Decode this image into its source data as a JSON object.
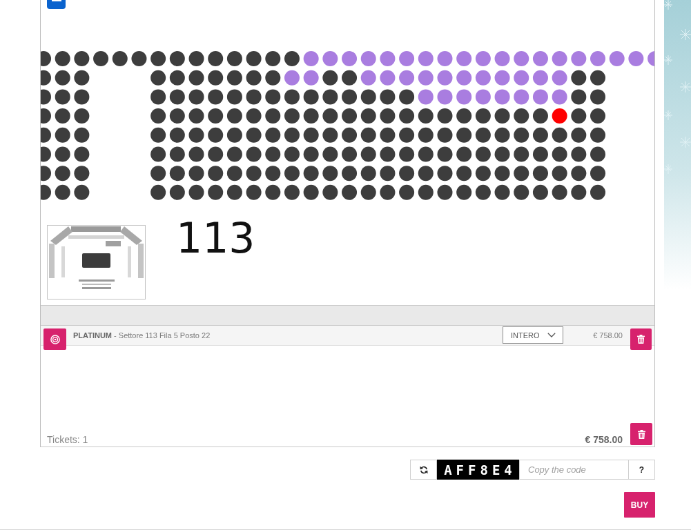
{
  "seat_map": {
    "rows": [
      {
        "blocks": [
          {
            "seats": [
              {
                "kind": "sold",
                "selected": false
              },
              {
                "kind": "sold",
                "selected": false
              },
              {
                "kind": "sold",
                "selected": false
              },
              {
                "kind": "sold",
                "selected": false
              },
              {
                "kind": "sold",
                "selected": false
              },
              {
                "kind": "sold",
                "selected": false
              },
              {
                "kind": "sold",
                "selected": false
              },
              {
                "kind": "sold",
                "selected": false
              },
              {
                "kind": "sold",
                "selected": false
              },
              {
                "kind": "sold",
                "selected": false
              },
              {
                "kind": "sold",
                "selected": false
              },
              {
                "kind": "sold",
                "selected": false
              },
              {
                "kind": "sold",
                "selected": false
              },
              {
                "kind": "sold",
                "selected": false
              },
              {
                "kind": "free",
                "selected": false
              },
              {
                "kind": "free",
                "selected": false
              },
              {
                "kind": "free",
                "selected": false
              },
              {
                "kind": "free",
                "selected": false
              },
              {
                "kind": "free",
                "selected": false
              },
              {
                "kind": "free",
                "selected": false
              },
              {
                "kind": "free",
                "selected": false
              },
              {
                "kind": "free",
                "selected": false
              },
              {
                "kind": "free",
                "selected": false
              },
              {
                "kind": "free",
                "selected": false
              },
              {
                "kind": "free",
                "selected": false
              },
              {
                "kind": "free",
                "selected": false
              },
              {
                "kind": "free",
                "selected": false
              },
              {
                "kind": "free",
                "selected": false
              },
              {
                "kind": "free",
                "selected": false
              },
              {
                "kind": "free",
                "selected": false
              },
              {
                "kind": "free",
                "selected": false
              },
              {
                "kind": "free",
                "selected": false
              },
              {
                "kind": "free",
                "selected": false
              }
            ]
          }
        ]
      },
      {
        "blocks": [
          {
            "seats": [
              {
                "kind": "sold",
                "selected": false
              },
              {
                "kind": "sold",
                "selected": false
              },
              {
                "kind": "sold",
                "selected": false
              }
            ]
          },
          {
            "seats": [
              {
                "kind": "sold",
                "selected": false
              },
              {
                "kind": "sold",
                "selected": false
              },
              {
                "kind": "sold",
                "selected": false
              },
              {
                "kind": "sold",
                "selected": false
              },
              {
                "kind": "sold",
                "selected": false
              },
              {
                "kind": "sold",
                "selected": false
              },
              {
                "kind": "sold",
                "selected": false
              },
              {
                "kind": "free",
                "selected": false
              },
              {
                "kind": "free",
                "selected": false
              },
              {
                "kind": "sold",
                "selected": false
              },
              {
                "kind": "sold",
                "selected": false
              },
              {
                "kind": "free",
                "selected": false
              },
              {
                "kind": "free",
                "selected": false
              },
              {
                "kind": "free",
                "selected": false
              },
              {
                "kind": "free",
                "selected": false
              },
              {
                "kind": "free",
                "selected": false
              },
              {
                "kind": "free",
                "selected": false
              },
              {
                "kind": "free",
                "selected": false
              },
              {
                "kind": "free",
                "selected": false
              },
              {
                "kind": "free",
                "selected": false
              },
              {
                "kind": "free",
                "selected": false
              },
              {
                "kind": "free",
                "selected": false
              },
              {
                "kind": "sold",
                "selected": false
              },
              {
                "kind": "sold",
                "selected": false
              }
            ]
          }
        ]
      },
      {
        "blocks": [
          {
            "seats": [
              {
                "kind": "sold",
                "selected": false
              },
              {
                "kind": "sold",
                "selected": false
              },
              {
                "kind": "sold",
                "selected": false
              }
            ]
          },
          {
            "seats": [
              {
                "kind": "sold",
                "selected": false
              },
              {
                "kind": "sold",
                "selected": false
              },
              {
                "kind": "sold",
                "selected": false
              },
              {
                "kind": "sold",
                "selected": false
              },
              {
                "kind": "sold",
                "selected": false
              },
              {
                "kind": "sold",
                "selected": false
              },
              {
                "kind": "sold",
                "selected": false
              },
              {
                "kind": "sold",
                "selected": false
              },
              {
                "kind": "sold",
                "selected": false
              },
              {
                "kind": "sold",
                "selected": false
              },
              {
                "kind": "sold",
                "selected": false
              },
              {
                "kind": "sold",
                "selected": false
              },
              {
                "kind": "sold",
                "selected": false
              },
              {
                "kind": "sold",
                "selected": false
              },
              {
                "kind": "free",
                "selected": false
              },
              {
                "kind": "free",
                "selected": false
              },
              {
                "kind": "free",
                "selected": false
              },
              {
                "kind": "free",
                "selected": false
              },
              {
                "kind": "free",
                "selected": false
              },
              {
                "kind": "free",
                "selected": false
              },
              {
                "kind": "free",
                "selected": false
              },
              {
                "kind": "free",
                "selected": false
              },
              {
                "kind": "sold",
                "selected": false
              },
              {
                "kind": "sold",
                "selected": false
              }
            ]
          }
        ]
      },
      {
        "blocks": [
          {
            "seats": [
              {
                "kind": "sold",
                "selected": false
              },
              {
                "kind": "sold",
                "selected": false
              },
              {
                "kind": "sold",
                "selected": false
              }
            ]
          },
          {
            "seats": [
              {
                "kind": "sold",
                "selected": false
              },
              {
                "kind": "sold",
                "selected": false
              },
              {
                "kind": "sold",
                "selected": false
              },
              {
                "kind": "sold",
                "selected": false
              },
              {
                "kind": "sold",
                "selected": false
              },
              {
                "kind": "sold",
                "selected": false
              },
              {
                "kind": "sold",
                "selected": false
              },
              {
                "kind": "sold",
                "selected": false
              },
              {
                "kind": "sold",
                "selected": false
              },
              {
                "kind": "sold",
                "selected": false
              },
              {
                "kind": "sold",
                "selected": false
              },
              {
                "kind": "sold",
                "selected": false
              },
              {
                "kind": "sold",
                "selected": false
              },
              {
                "kind": "sold",
                "selected": false
              },
              {
                "kind": "sold",
                "selected": false
              },
              {
                "kind": "sold",
                "selected": false
              },
              {
                "kind": "sold",
                "selected": false
              },
              {
                "kind": "sold",
                "selected": false
              },
              {
                "kind": "sold",
                "selected": false
              },
              {
                "kind": "sold",
                "selected": false
              },
              {
                "kind": "sold",
                "selected": false
              },
              {
                "kind": "free",
                "selected": true
              },
              {
                "kind": "sold",
                "selected": false
              },
              {
                "kind": "sold",
                "selected": false
              }
            ]
          }
        ]
      },
      {
        "blocks": [
          {
            "seats": [
              {
                "kind": "sold",
                "selected": false
              },
              {
                "kind": "sold",
                "selected": false
              },
              {
                "kind": "sold",
                "selected": false
              }
            ]
          },
          {
            "seats": [
              {
                "kind": "sold",
                "selected": false
              },
              {
                "kind": "sold",
                "selected": false
              },
              {
                "kind": "sold",
                "selected": false
              },
              {
                "kind": "sold",
                "selected": false
              },
              {
                "kind": "sold",
                "selected": false
              },
              {
                "kind": "sold",
                "selected": false
              },
              {
                "kind": "sold",
                "selected": false
              },
              {
                "kind": "sold",
                "selected": false
              },
              {
                "kind": "sold",
                "selected": false
              },
              {
                "kind": "sold",
                "selected": false
              },
              {
                "kind": "sold",
                "selected": false
              },
              {
                "kind": "sold",
                "selected": false
              },
              {
                "kind": "sold",
                "selected": false
              },
              {
                "kind": "sold",
                "selected": false
              },
              {
                "kind": "sold",
                "selected": false
              },
              {
                "kind": "sold",
                "selected": false
              },
              {
                "kind": "sold",
                "selected": false
              },
              {
                "kind": "sold",
                "selected": false
              },
              {
                "kind": "sold",
                "selected": false
              },
              {
                "kind": "sold",
                "selected": false
              },
              {
                "kind": "sold",
                "selected": false
              },
              {
                "kind": "sold",
                "selected": false
              },
              {
                "kind": "sold",
                "selected": false
              },
              {
                "kind": "sold",
                "selected": false
              }
            ]
          }
        ]
      },
      {
        "blocks": [
          {
            "seats": [
              {
                "kind": "sold",
                "selected": false
              },
              {
                "kind": "sold",
                "selected": false
              },
              {
                "kind": "sold",
                "selected": false
              }
            ]
          },
          {
            "seats": [
              {
                "kind": "sold",
                "selected": false
              },
              {
                "kind": "sold",
                "selected": false
              },
              {
                "kind": "sold",
                "selected": false
              },
              {
                "kind": "sold",
                "selected": false
              },
              {
                "kind": "sold",
                "selected": false
              },
              {
                "kind": "sold",
                "selected": false
              },
              {
                "kind": "sold",
                "selected": false
              },
              {
                "kind": "sold",
                "selected": false
              },
              {
                "kind": "sold",
                "selected": false
              },
              {
                "kind": "sold",
                "selected": false
              },
              {
                "kind": "sold",
                "selected": false
              },
              {
                "kind": "sold",
                "selected": false
              },
              {
                "kind": "sold",
                "selected": false
              },
              {
                "kind": "sold",
                "selected": false
              },
              {
                "kind": "sold",
                "selected": false
              },
              {
                "kind": "sold",
                "selected": false
              },
              {
                "kind": "sold",
                "selected": false
              },
              {
                "kind": "sold",
                "selected": false
              },
              {
                "kind": "sold",
                "selected": false
              },
              {
                "kind": "sold",
                "selected": false
              },
              {
                "kind": "sold",
                "selected": false
              },
              {
                "kind": "sold",
                "selected": false
              },
              {
                "kind": "sold",
                "selected": false
              },
              {
                "kind": "sold",
                "selected": false
              }
            ]
          }
        ]
      },
      {
        "blocks": [
          {
            "seats": [
              {
                "kind": "sold",
                "selected": false
              },
              {
                "kind": "sold",
                "selected": false
              },
              {
                "kind": "sold",
                "selected": false
              }
            ]
          },
          {
            "seats": [
              {
                "kind": "sold",
                "selected": false
              },
              {
                "kind": "sold",
                "selected": false
              },
              {
                "kind": "sold",
                "selected": false
              },
              {
                "kind": "sold",
                "selected": false
              },
              {
                "kind": "sold",
                "selected": false
              },
              {
                "kind": "sold",
                "selected": false
              },
              {
                "kind": "sold",
                "selected": false
              },
              {
                "kind": "sold",
                "selected": false
              },
              {
                "kind": "sold",
                "selected": false
              },
              {
                "kind": "sold",
                "selected": false
              },
              {
                "kind": "sold",
                "selected": false
              },
              {
                "kind": "sold",
                "selected": false
              },
              {
                "kind": "sold",
                "selected": false
              },
              {
                "kind": "sold",
                "selected": false
              },
              {
                "kind": "sold",
                "selected": false
              },
              {
                "kind": "sold",
                "selected": false
              },
              {
                "kind": "sold",
                "selected": false
              },
              {
                "kind": "sold",
                "selected": false
              },
              {
                "kind": "sold",
                "selected": false
              },
              {
                "kind": "sold",
                "selected": false
              },
              {
                "kind": "sold",
                "selected": false
              },
              {
                "kind": "sold",
                "selected": false
              },
              {
                "kind": "sold",
                "selected": false
              },
              {
                "kind": "sold",
                "selected": false
              }
            ]
          }
        ]
      },
      {
        "blocks": [
          {
            "seats": [
              {
                "kind": "sold",
                "selected": false
              },
              {
                "kind": "sold",
                "selected": false
              },
              {
                "kind": "sold",
                "selected": false
              }
            ]
          },
          {
            "seats": [
              {
                "kind": "sold",
                "selected": false
              },
              {
                "kind": "sold",
                "selected": false
              },
              {
                "kind": "sold",
                "selected": false
              },
              {
                "kind": "sold",
                "selected": false
              },
              {
                "kind": "sold",
                "selected": false
              },
              {
                "kind": "sold",
                "selected": false
              },
              {
                "kind": "sold",
                "selected": false
              },
              {
                "kind": "sold",
                "selected": false
              },
              {
                "kind": "sold",
                "selected": false
              },
              {
                "kind": "sold",
                "selected": false
              },
              {
                "kind": "sold",
                "selected": false
              },
              {
                "kind": "sold",
                "selected": false
              },
              {
                "kind": "sold",
                "selected": false
              },
              {
                "kind": "sold",
                "selected": false
              },
              {
                "kind": "sold",
                "selected": false
              },
              {
                "kind": "sold",
                "selected": false
              },
              {
                "kind": "sold",
                "selected": false
              },
              {
                "kind": "sold",
                "selected": false
              },
              {
                "kind": "sold",
                "selected": false
              },
              {
                "kind": "sold",
                "selected": false
              },
              {
                "kind": "sold",
                "selected": false
              },
              {
                "kind": "sold",
                "selected": false
              },
              {
                "kind": "sold",
                "selected": false
              },
              {
                "kind": "sold",
                "selected": false
              }
            ]
          }
        ]
      }
    ],
    "sector_labels": [
      "113"
    ]
  },
  "cart": {
    "items": [
      {
        "description": "**PLATINUM** - Settore 113 Fila 5 Posto 22",
        "ticket_type": "INTERO",
        "price": "€ 758.00"
      }
    ],
    "tickets": "Tickets: 1",
    "total": "€ 758.00"
  },
  "captcha": {
    "code": "AFF8E4",
    "placeholder": "Copy the code",
    "help_label": "?"
  },
  "buy_label": "BUY"
}
